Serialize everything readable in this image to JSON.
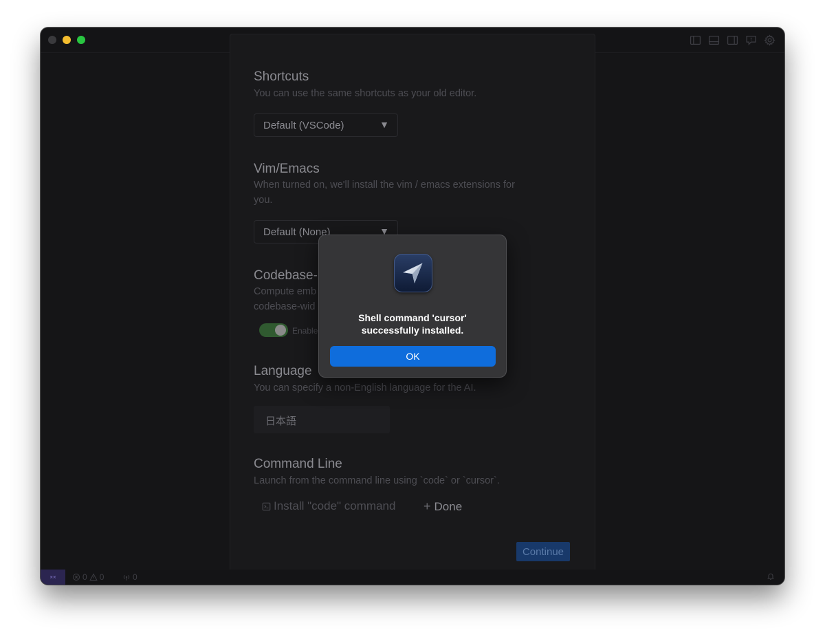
{
  "window": {
    "traffic_lights": [
      "close",
      "minimize",
      "maximize"
    ],
    "title_icons": [
      "sidebar-left-icon",
      "panel-bottom-icon",
      "split-editor-icon",
      "feedback-icon",
      "gear-icon"
    ]
  },
  "shortcuts": {
    "title": "Shortcuts",
    "description": "You can use the same shortcuts as your old editor.",
    "selected": "Default (VSCode)"
  },
  "vim_emacs": {
    "title": "Vim/Emacs",
    "description": "When turned on, we'll install the vim / emacs extensions for you.",
    "selected": "Default (None)"
  },
  "codebase": {
    "title": "Codebase-",
    "description_line1": "Compute emb",
    "description_line2": "codebase-wid",
    "toggle_label": "Enable",
    "enabled": true
  },
  "language": {
    "title": "Language",
    "description": "You can specify a non-English language for the AI.",
    "value": "日本語"
  },
  "command_line": {
    "title": "Command Line",
    "description": "Launch from the command line using `code` or `cursor`.",
    "install_label": "Install \"code\" command",
    "done_label": "Done"
  },
  "continue_label": "Continue",
  "dialog": {
    "message_line1": "Shell command 'cursor'",
    "message_line2": "successfully installed.",
    "ok_label": "OK"
  },
  "statusbar": {
    "errors": "0",
    "warnings": "0",
    "ports": "0"
  },
  "colors": {
    "accent": "#0f6ddc",
    "toggle_on": "#305a30",
    "continue_bg": "#18396a"
  }
}
